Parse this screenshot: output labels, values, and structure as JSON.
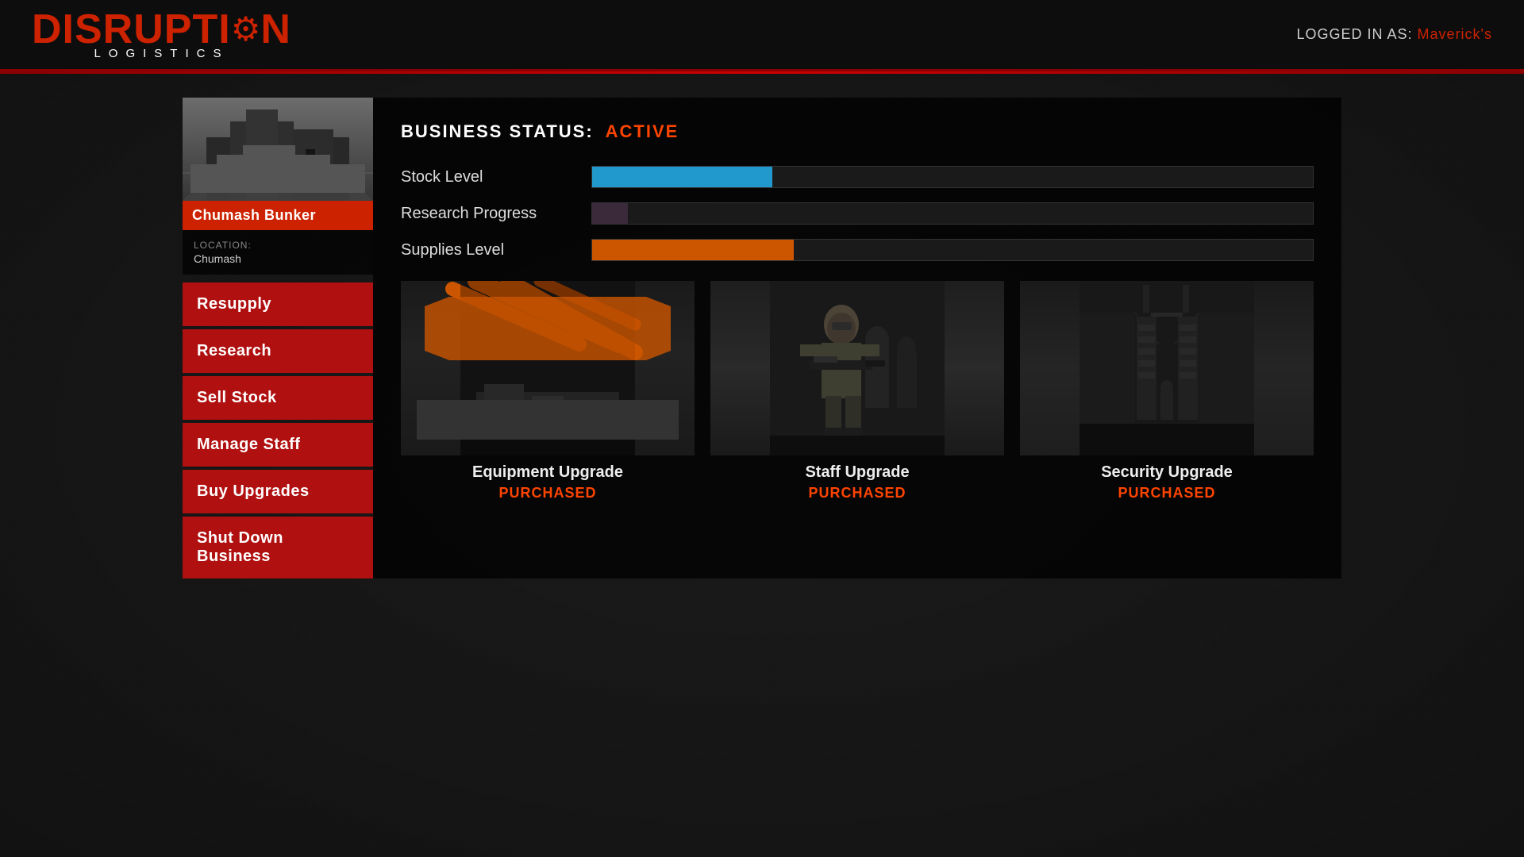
{
  "header": {
    "logo_main": "DISRUPTI",
    "logo_gear": "⚙",
    "logo_end": "N",
    "logo_full": "DISRUPTION",
    "logo_subtitle": "LOGISTICS",
    "logged_in_label": "LOGGED IN AS:",
    "logged_in_user": "Maverick's"
  },
  "left_panel": {
    "bunker_name": "Chumash Bunker",
    "location_label": "LOCATION:",
    "location_value": "Chumash"
  },
  "menu": {
    "buttons": [
      {
        "id": "resupply",
        "label": "Resupply"
      },
      {
        "id": "research",
        "label": "Research"
      },
      {
        "id": "sell-stock",
        "label": "Sell Stock"
      },
      {
        "id": "manage-staff",
        "label": "Manage Staff"
      },
      {
        "id": "buy-upgrades",
        "label": "Buy Upgrades"
      },
      {
        "id": "shut-down",
        "label": "Shut Down Business"
      }
    ]
  },
  "business": {
    "status_label": "BUSINESS STATUS:",
    "status_value": "ACTIVE",
    "stats": [
      {
        "id": "stock",
        "label": "Stock Level",
        "fill_pct": 25,
        "color": "blue"
      },
      {
        "id": "research",
        "label": "Research Progress",
        "fill_pct": 4,
        "color": "dark"
      },
      {
        "id": "supplies",
        "label": "Supplies Level",
        "fill_pct": 28,
        "color": "orange"
      }
    ],
    "upgrades": [
      {
        "id": "equipment",
        "title": "Equipment Upgrade",
        "status": "PURCHASED",
        "type": "equipment"
      },
      {
        "id": "staff",
        "title": "Staff Upgrade",
        "status": "PURCHASED",
        "type": "staff"
      },
      {
        "id": "security",
        "title": "Security Upgrade",
        "status": "PURCHASED",
        "type": "security"
      }
    ]
  }
}
